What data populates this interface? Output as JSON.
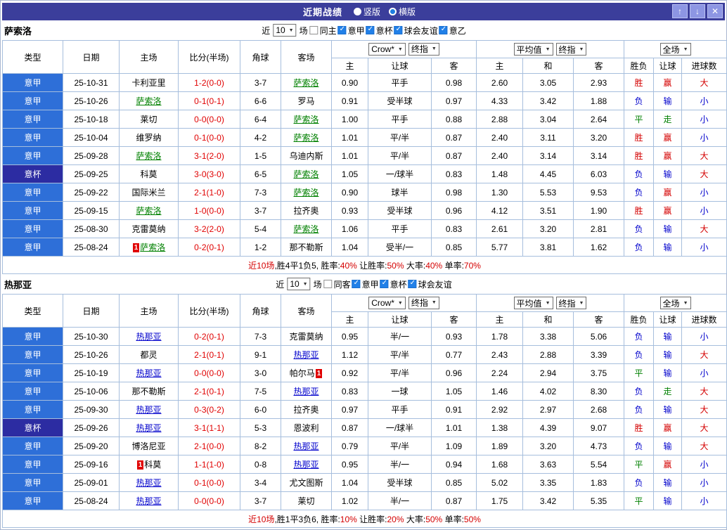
{
  "titlebar": {
    "title": "近期战绩",
    "view_options": [
      {
        "label": "竖版",
        "selected": false
      },
      {
        "label": "横版",
        "selected": true
      }
    ],
    "up_icon": "↑",
    "down_icon": "↓",
    "close_icon": "✕"
  },
  "table_header": {
    "type": "类型",
    "date": "日期",
    "home": "主场",
    "score": "比分(半场)",
    "corner": "角球",
    "away": "客场",
    "selects": {
      "odds": [
        "Crow*",
        "终指"
      ],
      "avg": [
        "平均值",
        "终指"
      ],
      "result": [
        "全场"
      ]
    },
    "odds_cols": [
      "主",
      "让球",
      "客"
    ],
    "avg_cols": [
      "主",
      "和",
      "客"
    ],
    "result_cols": [
      "胜负",
      "让球",
      "进球数"
    ]
  },
  "result_colors": {
    "胜": "#d40000",
    "负": "#0000cc",
    "平": "#008000",
    "赢": "#d40000",
    "输": "#0000cc",
    "走": "#008000",
    "大": "#d40000",
    "小": "#0000cc"
  },
  "sections": [
    {
      "team": "萨索洛",
      "team_color": "#008000",
      "filters": {
        "prefix": "近",
        "count": "10",
        "suffix": "场",
        "checkboxes": [
          {
            "label": "同主",
            "checked": false
          },
          {
            "label": "意甲",
            "checked": true
          },
          {
            "label": "意杯",
            "checked": true
          },
          {
            "label": "球会友谊",
            "checked": true
          },
          {
            "label": "意乙",
            "checked": true
          }
        ]
      },
      "rows": [
        {
          "league": "意甲",
          "cup": false,
          "date": "25-10-31",
          "home": {
            "name": "卡利亚里"
          },
          "score": "1-2(0-0)",
          "corner": "3-7",
          "away": {
            "name": "萨索洛",
            "target": true
          },
          "asian": [
            "0.90",
            "平手",
            "0.98"
          ],
          "euro": [
            "2.60",
            "3.05",
            "2.93"
          ],
          "results": [
            "胜",
            "赢",
            "大"
          ]
        },
        {
          "league": "意甲",
          "cup": false,
          "date": "25-10-26",
          "home": {
            "name": "萨索洛",
            "target": true
          },
          "score": "0-1(0-1)",
          "corner": "6-6",
          "away": {
            "name": "罗马"
          },
          "asian": [
            "0.91",
            "受半球",
            "0.97"
          ],
          "euro": [
            "4.33",
            "3.42",
            "1.88"
          ],
          "results": [
            "负",
            "输",
            "小"
          ]
        },
        {
          "league": "意甲",
          "cup": false,
          "date": "25-10-18",
          "home": {
            "name": "莱切"
          },
          "score": "0-0(0-0)",
          "corner": "6-4",
          "away": {
            "name": "萨索洛",
            "target": true
          },
          "asian": [
            "1.00",
            "平手",
            "0.88"
          ],
          "euro": [
            "2.88",
            "3.04",
            "2.64"
          ],
          "results": [
            "平",
            "走",
            "小"
          ]
        },
        {
          "league": "意甲",
          "cup": false,
          "date": "25-10-04",
          "home": {
            "name": "维罗纳"
          },
          "score": "0-1(0-0)",
          "corner": "4-2",
          "away": {
            "name": "萨索洛",
            "target": true
          },
          "asian": [
            "1.01",
            "平/半",
            "0.87"
          ],
          "euro": [
            "2.40",
            "3.11",
            "3.20"
          ],
          "results": [
            "胜",
            "赢",
            "小"
          ]
        },
        {
          "league": "意甲",
          "cup": false,
          "date": "25-09-28",
          "home": {
            "name": "萨索洛",
            "target": true
          },
          "score": "3-1(2-0)",
          "corner": "1-5",
          "away": {
            "name": "乌迪内斯"
          },
          "asian": [
            "1.01",
            "平/半",
            "0.87"
          ],
          "euro": [
            "2.40",
            "3.14",
            "3.14"
          ],
          "results": [
            "胜",
            "赢",
            "大"
          ]
        },
        {
          "league": "意杯",
          "cup": true,
          "date": "25-09-25",
          "home": {
            "name": "科莫"
          },
          "score": "3-0(3-0)",
          "corner": "6-5",
          "away": {
            "name": "萨索洛",
            "target": true
          },
          "asian": [
            "1.05",
            "一/球半",
            "0.83"
          ],
          "euro": [
            "1.48",
            "4.45",
            "6.03"
          ],
          "results": [
            "负",
            "输",
            "大"
          ]
        },
        {
          "league": "意甲",
          "cup": false,
          "date": "25-09-22",
          "home": {
            "name": "国际米兰"
          },
          "score": "2-1(1-0)",
          "corner": "7-3",
          "away": {
            "name": "萨索洛",
            "target": true
          },
          "asian": [
            "0.90",
            "球半",
            "0.98"
          ],
          "euro": [
            "1.30",
            "5.53",
            "9.53"
          ],
          "results": [
            "负",
            "赢",
            "小"
          ]
        },
        {
          "league": "意甲",
          "cup": false,
          "date": "25-09-15",
          "home": {
            "name": "萨索洛",
            "target": true
          },
          "score": "1-0(0-0)",
          "corner": "3-7",
          "away": {
            "name": "拉齐奥"
          },
          "asian": [
            "0.93",
            "受半球",
            "0.96"
          ],
          "euro": [
            "4.12",
            "3.51",
            "1.90"
          ],
          "results": [
            "胜",
            "赢",
            "小"
          ]
        },
        {
          "league": "意甲",
          "cup": false,
          "date": "25-08-30",
          "home": {
            "name": "克雷莫纳"
          },
          "score": "3-2(2-0)",
          "corner": "5-4",
          "away": {
            "name": "萨索洛",
            "target": true
          },
          "asian": [
            "1.06",
            "平手",
            "0.83"
          ],
          "euro": [
            "2.61",
            "3.20",
            "2.81"
          ],
          "results": [
            "负",
            "输",
            "大"
          ]
        },
        {
          "league": "意甲",
          "cup": false,
          "date": "25-08-24",
          "home": {
            "name": "萨索洛",
            "target": true,
            "card": {
              "pos": "before",
              "n": "1"
            }
          },
          "score": "0-2(0-1)",
          "corner": "1-2",
          "away": {
            "name": "那不勒斯"
          },
          "asian": [
            "1.04",
            "受半/一",
            "0.85"
          ],
          "euro": [
            "5.77",
            "3.81",
            "1.62"
          ],
          "results": [
            "负",
            "输",
            "小"
          ]
        }
      ],
      "summary": [
        {
          "text": "近10场",
          "color": "#d40000"
        },
        {
          "text": ",胜4平1负5, 胜率:",
          "color": "#000000"
        },
        {
          "text": "40%",
          "color": "#d40000"
        },
        {
          "text": " 让胜率:",
          "color": "#000000"
        },
        {
          "text": "50%",
          "color": "#d40000"
        },
        {
          "text": " 大率:",
          "color": "#000000"
        },
        {
          "text": "40%",
          "color": "#d40000"
        },
        {
          "text": " 单率:",
          "color": "#000000"
        },
        {
          "text": "70%",
          "color": "#d40000"
        }
      ]
    },
    {
      "team": "热那亚",
      "team_color": "#0000cc",
      "filters": {
        "prefix": "近",
        "count": "10",
        "suffix": "场",
        "checkboxes": [
          {
            "label": "同客",
            "checked": false
          },
          {
            "label": "意甲",
            "checked": true
          },
          {
            "label": "意杯",
            "checked": true
          },
          {
            "label": "球会友谊",
            "checked": true
          }
        ]
      },
      "rows": [
        {
          "league": "意甲",
          "cup": false,
          "date": "25-10-30",
          "home": {
            "name": "热那亚",
            "target": true
          },
          "score": "0-2(0-1)",
          "corner": "7-3",
          "away": {
            "name": "克雷莫纳"
          },
          "asian": [
            "0.95",
            "半/一",
            "0.93"
          ],
          "euro": [
            "1.78",
            "3.38",
            "5.06"
          ],
          "results": [
            "负",
            "输",
            "小"
          ]
        },
        {
          "league": "意甲",
          "cup": false,
          "date": "25-10-26",
          "home": {
            "name": "都灵"
          },
          "score": "2-1(0-1)",
          "corner": "9-1",
          "away": {
            "name": "热那亚",
            "target": true
          },
          "asian": [
            "1.12",
            "平/半",
            "0.77"
          ],
          "euro": [
            "2.43",
            "2.88",
            "3.39"
          ],
          "results": [
            "负",
            "输",
            "大"
          ]
        },
        {
          "league": "意甲",
          "cup": false,
          "date": "25-10-19",
          "home": {
            "name": "热那亚",
            "target": true
          },
          "score": "0-0(0-0)",
          "corner": "3-0",
          "away": {
            "name": "帕尔马",
            "card": {
              "pos": "after",
              "n": "1"
            }
          },
          "asian": [
            "0.92",
            "平/半",
            "0.96"
          ],
          "euro": [
            "2.24",
            "2.94",
            "3.75"
          ],
          "results": [
            "平",
            "输",
            "小"
          ]
        },
        {
          "league": "意甲",
          "cup": false,
          "date": "25-10-06",
          "home": {
            "name": "那不勒斯"
          },
          "score": "2-1(0-1)",
          "corner": "7-5",
          "away": {
            "name": "热那亚",
            "target": true
          },
          "asian": [
            "0.83",
            "一球",
            "1.05"
          ],
          "euro": [
            "1.46",
            "4.02",
            "8.30"
          ],
          "results": [
            "负",
            "走",
            "大"
          ]
        },
        {
          "league": "意甲",
          "cup": false,
          "date": "25-09-30",
          "home": {
            "name": "热那亚",
            "target": true
          },
          "score": "0-3(0-2)",
          "corner": "6-0",
          "away": {
            "name": "拉齐奥"
          },
          "asian": [
            "0.97",
            "平手",
            "0.91"
          ],
          "euro": [
            "2.92",
            "2.97",
            "2.68"
          ],
          "results": [
            "负",
            "输",
            "大"
          ]
        },
        {
          "league": "意杯",
          "cup": true,
          "date": "25-09-26",
          "home": {
            "name": "热那亚",
            "target": true
          },
          "score": "3-1(1-1)",
          "corner": "5-3",
          "away": {
            "name": "恩波利"
          },
          "asian": [
            "0.87",
            "一/球半",
            "1.01"
          ],
          "euro": [
            "1.38",
            "4.39",
            "9.07"
          ],
          "results": [
            "胜",
            "赢",
            "大"
          ]
        },
        {
          "league": "意甲",
          "cup": false,
          "date": "25-09-20",
          "home": {
            "name": "博洛尼亚"
          },
          "score": "2-1(0-0)",
          "corner": "8-2",
          "away": {
            "name": "热那亚",
            "target": true
          },
          "asian": [
            "0.79",
            "平/半",
            "1.09"
          ],
          "euro": [
            "1.89",
            "3.20",
            "4.73"
          ],
          "results": [
            "负",
            "输",
            "大"
          ]
        },
        {
          "league": "意甲",
          "cup": false,
          "date": "25-09-16",
          "home": {
            "name": "科莫",
            "card": {
              "pos": "before",
              "n": "1"
            }
          },
          "score": "1-1(1-0)",
          "corner": "0-8",
          "away": {
            "name": "热那亚",
            "target": true
          },
          "asian": [
            "0.95",
            "半/一",
            "0.94"
          ],
          "euro": [
            "1.68",
            "3.63",
            "5.54"
          ],
          "results": [
            "平",
            "赢",
            "小"
          ]
        },
        {
          "league": "意甲",
          "cup": false,
          "date": "25-09-01",
          "home": {
            "name": "热那亚",
            "target": true
          },
          "score": "0-1(0-0)",
          "corner": "3-4",
          "away": {
            "name": "尤文图斯"
          },
          "asian": [
            "1.04",
            "受半球",
            "0.85"
          ],
          "euro": [
            "5.02",
            "3.35",
            "1.83"
          ],
          "results": [
            "负",
            "输",
            "小"
          ]
        },
        {
          "league": "意甲",
          "cup": false,
          "date": "25-08-24",
          "home": {
            "name": "热那亚",
            "target": true
          },
          "score": "0-0(0-0)",
          "corner": "3-7",
          "away": {
            "name": "莱切"
          },
          "asian": [
            "1.02",
            "半/一",
            "0.87"
          ],
          "euro": [
            "1.75",
            "3.42",
            "5.35"
          ],
          "results": [
            "平",
            "输",
            "小"
          ]
        }
      ],
      "summary": [
        {
          "text": "近10场",
          "color": "#d40000"
        },
        {
          "text": ",胜1平3负6, 胜率:",
          "color": "#000000"
        },
        {
          "text": "10%",
          "color": "#d40000"
        },
        {
          "text": " 让胜率:",
          "color": "#000000"
        },
        {
          "text": "20%",
          "color": "#d40000"
        },
        {
          "text": " 大率:",
          "color": "#000000"
        },
        {
          "text": "50%",
          "color": "#d40000"
        },
        {
          "text": " 单率:",
          "color": "#000000"
        },
        {
          "text": "50%",
          "color": "#d40000"
        }
      ]
    }
  ]
}
